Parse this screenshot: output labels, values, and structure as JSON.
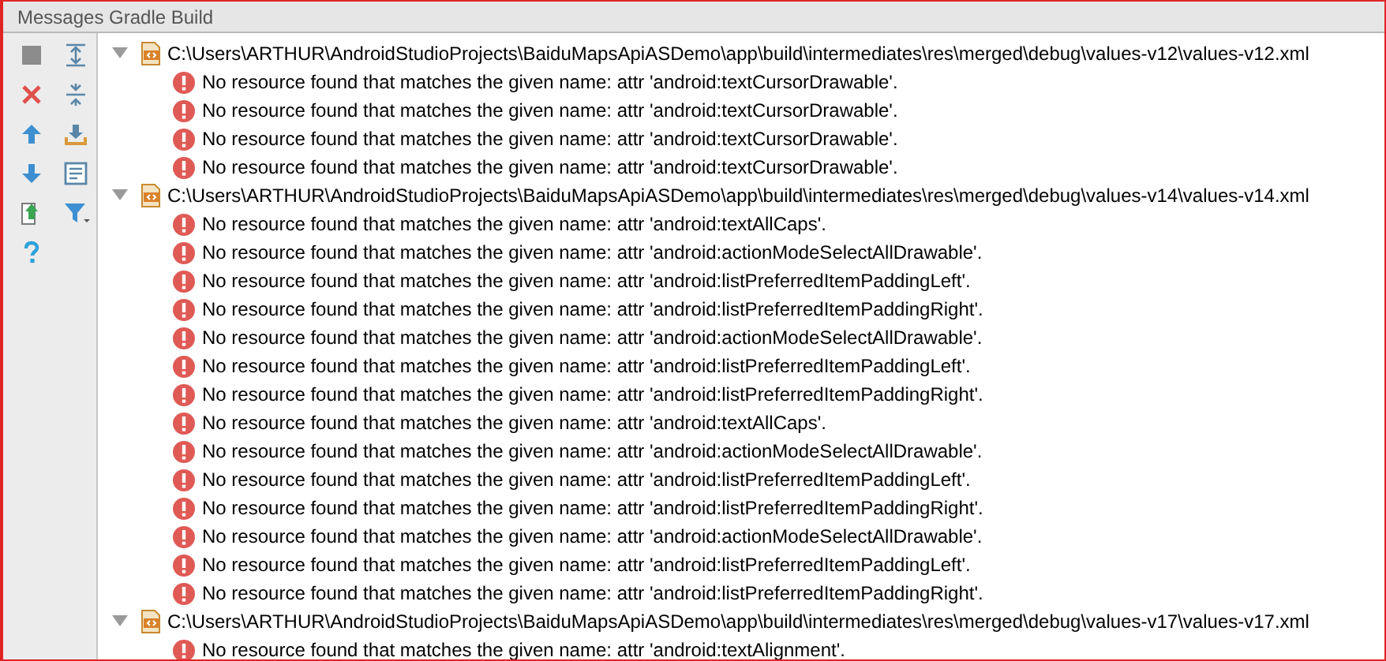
{
  "panel": {
    "title": "Messages Gradle Build"
  },
  "groups": [
    {
      "path": "C:\\Users\\ARTHUR\\AndroidStudioProjects\\BaiduMapsApiASDemo\\app\\build\\intermediates\\res\\merged\\debug\\values-v12\\values-v12.xml",
      "expanded": true,
      "messages": [
        {
          "kind": "error",
          "text": "No resource found that matches the given name: attr 'android:textCursorDrawable'."
        },
        {
          "kind": "error",
          "text": "No resource found that matches the given name: attr 'android:textCursorDrawable'."
        },
        {
          "kind": "error",
          "text": "No resource found that matches the given name: attr 'android:textCursorDrawable'."
        },
        {
          "kind": "error",
          "text": "No resource found that matches the given name: attr 'android:textCursorDrawable'."
        }
      ]
    },
    {
      "path": "C:\\Users\\ARTHUR\\AndroidStudioProjects\\BaiduMapsApiASDemo\\app\\build\\intermediates\\res\\merged\\debug\\values-v14\\values-v14.xml",
      "expanded": true,
      "messages": [
        {
          "kind": "error",
          "text": "No resource found that matches the given name: attr 'android:textAllCaps'."
        },
        {
          "kind": "error",
          "text": "No resource found that matches the given name: attr 'android:actionModeSelectAllDrawable'."
        },
        {
          "kind": "error",
          "text": "No resource found that matches the given name: attr 'android:listPreferredItemPaddingLeft'."
        },
        {
          "kind": "error",
          "text": "No resource found that matches the given name: attr 'android:listPreferredItemPaddingRight'."
        },
        {
          "kind": "error",
          "text": "No resource found that matches the given name: attr 'android:actionModeSelectAllDrawable'."
        },
        {
          "kind": "error",
          "text": "No resource found that matches the given name: attr 'android:listPreferredItemPaddingLeft'."
        },
        {
          "kind": "error",
          "text": "No resource found that matches the given name: attr 'android:listPreferredItemPaddingRight'."
        },
        {
          "kind": "error",
          "text": "No resource found that matches the given name: attr 'android:textAllCaps'."
        },
        {
          "kind": "error",
          "text": "No resource found that matches the given name: attr 'android:actionModeSelectAllDrawable'."
        },
        {
          "kind": "error",
          "text": "No resource found that matches the given name: attr 'android:listPreferredItemPaddingLeft'."
        },
        {
          "kind": "error",
          "text": "No resource found that matches the given name: attr 'android:listPreferredItemPaddingRight'."
        },
        {
          "kind": "error",
          "text": "No resource found that matches the given name: attr 'android:actionModeSelectAllDrawable'."
        },
        {
          "kind": "error",
          "text": "No resource found that matches the given name: attr 'android:listPreferredItemPaddingLeft'."
        },
        {
          "kind": "error",
          "text": "No resource found that matches the given name: attr 'android:listPreferredItemPaddingRight'."
        }
      ]
    },
    {
      "path": "C:\\Users\\ARTHUR\\AndroidStudioProjects\\BaiduMapsApiASDemo\\app\\build\\intermediates\\res\\merged\\debug\\values-v17\\values-v17.xml",
      "expanded": true,
      "messages": [
        {
          "kind": "error",
          "text": "No resource found that matches the given name: attr 'android:textAlignment'."
        }
      ]
    }
  ]
}
